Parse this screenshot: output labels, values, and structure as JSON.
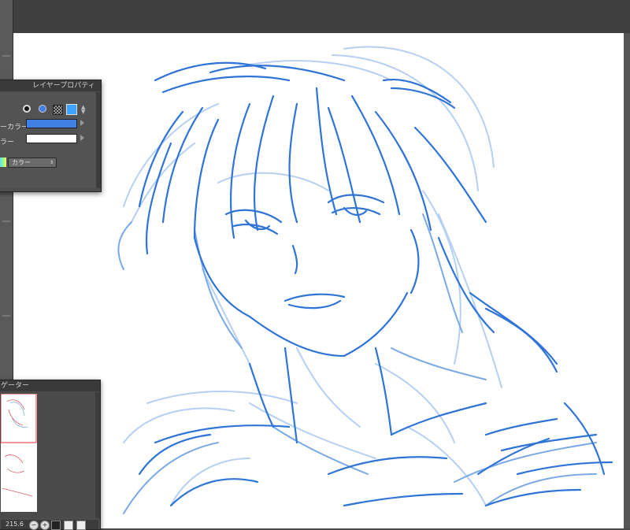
{
  "layer_property": {
    "title": "レイヤープロパティ",
    "line_color_label": "ーカラー",
    "sub_color_label": "ラー",
    "line_color": "#3f7fe6",
    "sub_color": "#ffffff",
    "color_mode_select": "カラー"
  },
  "navigator": {
    "title": "ゲーター",
    "zoom_value": "215.6"
  },
  "colors": {
    "sketch_blue": "#2f74d6",
    "sketch_light": "#a9c8ef",
    "topbar": "#3f3f3f",
    "canvas": "#ffffff"
  },
  "icons": [
    "zoom-out-icon",
    "zoom-in-icon",
    "fit-icon",
    "flip-icon",
    "rotate-icon"
  ]
}
